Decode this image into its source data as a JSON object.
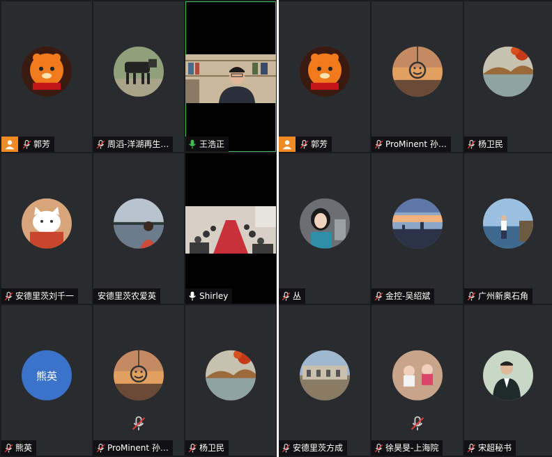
{
  "left_grid": [
    {
      "name": "郭芳",
      "host": true,
      "mic": "muted",
      "kind": "avatar",
      "avatar_icon": "tiger-avatar-icon"
    },
    {
      "name": "周滔-洋湖再生…",
      "mic": "muted",
      "kind": "avatar",
      "avatar_icon": "robot-dog-avatar-icon"
    },
    {
      "name": "王浩正",
      "mic": "speaking",
      "kind": "video",
      "active": true
    },
    {
      "name": "安德里茨刘千一",
      "mic": "muted",
      "kind": "avatar",
      "avatar_icon": "cat-avatar-icon"
    },
    {
      "name": "安德里茨农爱英",
      "mic": "none",
      "kind": "avatar",
      "avatar_icon": "lakeside-avatar-icon"
    },
    {
      "name": "Shirley",
      "mic": "on",
      "kind": "video"
    },
    {
      "name": "熊英",
      "mic": "muted",
      "kind": "text-avatar",
      "avatar_text": "熊英"
    },
    {
      "name": "ProMinent 孙…",
      "mic": "muted",
      "kind": "avatar",
      "avatar_icon": "sunset-smiley-avatar-icon",
      "center_muted": true
    },
    {
      "name": "杨卫民",
      "mic": "muted",
      "kind": "avatar",
      "avatar_icon": "autumn-lake-avatar-icon"
    }
  ],
  "right_grid": [
    {
      "name": "郭芳",
      "host": true,
      "mic": "muted",
      "kind": "avatar",
      "avatar_icon": "tiger-avatar-icon"
    },
    {
      "name": "ProMinent 孙…",
      "mic": "muted",
      "kind": "avatar",
      "avatar_icon": "sunset-smiley-avatar-icon"
    },
    {
      "name": "杨卫民",
      "mic": "muted",
      "kind": "avatar",
      "avatar_icon": "autumn-lake-avatar-icon"
    },
    {
      "name": "丛",
      "mic": "muted",
      "kind": "avatar",
      "avatar_icon": "girl-avatar-icon"
    },
    {
      "name": "金控-吴绍斌",
      "mic": "muted",
      "kind": "avatar",
      "avatar_icon": "city-skyline-avatar-icon"
    },
    {
      "name": "广州新奥石角",
      "mic": "muted",
      "kind": "avatar",
      "avatar_icon": "man-by-water-avatar-icon"
    },
    {
      "name": "安德里茨方成",
      "mic": "muted",
      "kind": "avatar",
      "avatar_icon": "building-avatar-icon"
    },
    {
      "name": "徐昊旻-上海院",
      "mic": "muted",
      "kind": "avatar",
      "avatar_icon": "babies-avatar-icon",
      "center_muted": true
    },
    {
      "name": "宋超秘书",
      "mic": "muted",
      "kind": "avatar",
      "avatar_icon": "man-portrait-avatar-icon"
    }
  ],
  "colors": {
    "host_badge": "#f08a24",
    "active_border": "#3fbf4f",
    "tile_bg": "#2a2b2f",
    "text_avatar_bg": "#3a73c9"
  }
}
